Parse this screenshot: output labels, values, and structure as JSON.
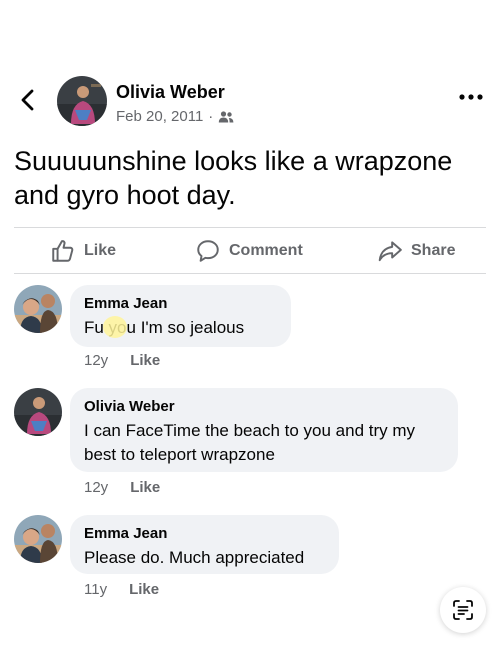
{
  "post": {
    "author": "Olivia Weber",
    "date": "Feb 20, 2011",
    "separator": "·",
    "audience_icon": "friends-icon",
    "text": "Suuuuunshine looks like a wrapzone and gyro hoot day."
  },
  "actions": {
    "like": "Like",
    "comment": "Comment",
    "share": "Share"
  },
  "comments": [
    {
      "name": "Emma Jean",
      "text": "Fu  you I'm so jealous",
      "age": "12y",
      "like": "Like"
    },
    {
      "name": "Olivia Weber",
      "text": "I can FaceTime the beach to you and try my best to teleport wrapzone",
      "age": "12y",
      "like": "Like"
    },
    {
      "name": "Emma Jean",
      "text": "Please do. Much appreciated",
      "age": "11y",
      "like": "Like"
    }
  ],
  "icons": {
    "back": "chevron-left-icon",
    "more": "more-horizontal-icon",
    "fab": "text-scan-icon"
  },
  "colors": {
    "text": "#050505",
    "muted": "#65676b",
    "bubble": "#f0f2f5",
    "divider": "#d9dadc"
  }
}
